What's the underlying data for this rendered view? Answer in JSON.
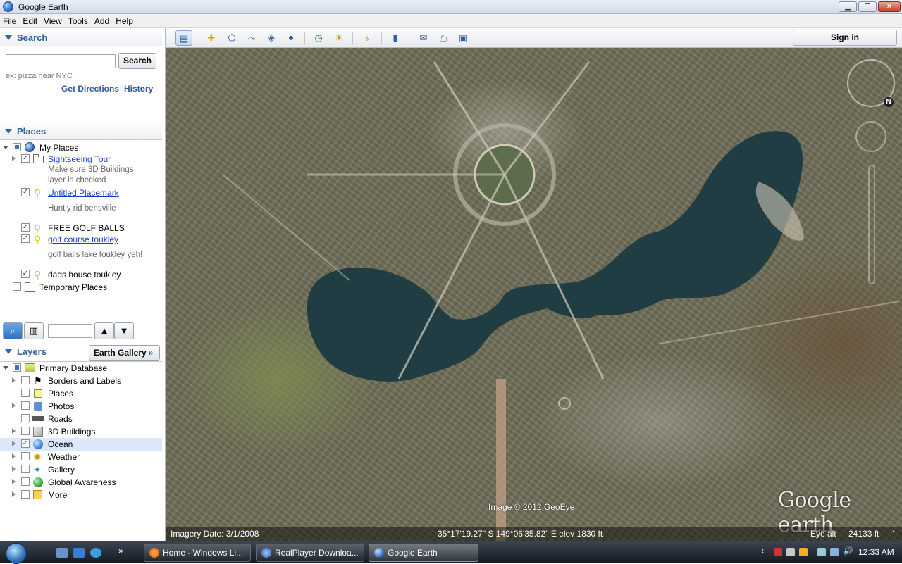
{
  "window": {
    "title": "Google Earth"
  },
  "menu": [
    "File",
    "Edit",
    "View",
    "Tools",
    "Add",
    "Help"
  ],
  "search": {
    "header": "Search",
    "input_value": "",
    "button": "Search",
    "hint": "ex: pizza near NYC",
    "get_directions": "Get Directions",
    "history": "History"
  },
  "places": {
    "header": "Places",
    "items": [
      {
        "label": "My Places",
        "checked": "partial",
        "icon": "globe-icon"
      },
      {
        "label": "Sightseeing Tour",
        "checked": "checked",
        "icon": "folder-icon",
        "link": true,
        "desc": [
          "Make sure 3D Buildings",
          "layer is checked"
        ]
      },
      {
        "label": "Untitled Placemark",
        "checked": "checked",
        "icon": "pin-icon",
        "link": true,
        "desc": [
          "Huntly rid bensville"
        ]
      },
      {
        "label": "FREE GOLF BALLS",
        "checked": "checked",
        "icon": "pin-icon",
        "link": false
      },
      {
        "label": "golf course toukley",
        "checked": "checked",
        "icon": "pin-icon",
        "link": true,
        "desc": [
          "golf balls lake toukley yeh!"
        ]
      },
      {
        "label": "dads house toukley",
        "checked": "checked",
        "icon": "pin-icon",
        "link": false
      },
      {
        "label": "Temporary Places",
        "checked": "none",
        "icon": "folder-icon"
      }
    ]
  },
  "layers": {
    "header": "Layers",
    "gallery_button": "Earth Gallery",
    "items": [
      {
        "label": "Primary Database",
        "checked": "partial",
        "icon": "database-icon"
      },
      {
        "label": "Borders and Labels",
        "checked": "none",
        "icon": "flag-icon"
      },
      {
        "label": "Places",
        "checked": "none",
        "icon": "places-icon"
      },
      {
        "label": "Photos",
        "checked": "none",
        "icon": "photo-icon"
      },
      {
        "label": "Roads",
        "checked": "none",
        "icon": "road-icon"
      },
      {
        "label": "3D Buildings",
        "checked": "none",
        "icon": "building-icon"
      },
      {
        "label": "Ocean",
        "checked": "checked",
        "icon": "ocean-icon",
        "selected": true
      },
      {
        "label": "Weather",
        "checked": "none",
        "icon": "weather-icon"
      },
      {
        "label": "Gallery",
        "checked": "none",
        "icon": "gallery-icon"
      },
      {
        "label": "Global Awareness",
        "checked": "none",
        "icon": "awareness-icon"
      },
      {
        "label": "More",
        "checked": "none",
        "icon": "more-icon"
      }
    ]
  },
  "toolbar": {
    "sign_in": "Sign in",
    "icons": [
      "sidebar-toggle-icon",
      "placemark-icon",
      "polygon-icon",
      "path-icon",
      "image-overlay-icon",
      "record-tour-icon",
      "historical-imagery-icon",
      "sunlight-icon",
      "planets-icon",
      "ruler-icon",
      "email-icon",
      "print-icon",
      "save-image-icon"
    ]
  },
  "map": {
    "image_credit": "Image © 2012 GeoEye",
    "logo": "Google earth",
    "imagery_date": "Imagery Date: 3/1/2008",
    "coords": "35°17'19.27\" S 149°06'35.82\" E elev  1830 ft",
    "eye_alt_label": "Eye alt",
    "eye_alt_value": "24133 ft"
  },
  "taskbar": {
    "tasks": [
      {
        "label": "Home - Windows Li...",
        "icon": "firefox-icon"
      },
      {
        "label": "RealPlayer Downloa...",
        "icon": "realplayer-icon"
      },
      {
        "label": "Google Earth",
        "icon": "google-earth-icon",
        "active": true
      }
    ],
    "clock": "12:33 AM"
  },
  "colors": {
    "accent": "#2f5f9e",
    "link": "#1a3ec4",
    "water": "#1d3a3f",
    "selected_row": "#dbe8fb"
  }
}
